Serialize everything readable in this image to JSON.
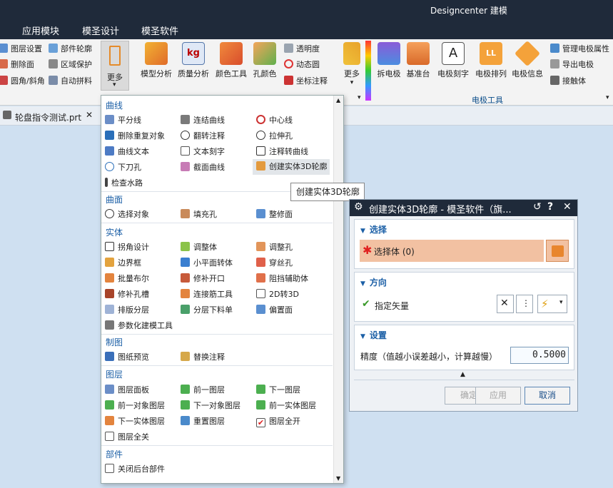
{
  "app": {
    "title": "Designcenter 建模"
  },
  "tabs": [
    "应用模块",
    "模圣设计",
    "模圣软件"
  ],
  "ribbon": {
    "small_col1": [
      "图层设置",
      "删除面",
      "圆角/斜角"
    ],
    "small_col2": [
      "部件轮廓",
      "区域保护",
      "自动拼料"
    ],
    "more1": "更多",
    "big1": [
      "模型分析",
      "质量分析",
      "颜色工具",
      "孔颜色"
    ],
    "small_col3": [
      "透明度",
      "动态圆",
      "坐标注释"
    ],
    "more2": "更多",
    "big2": [
      "拆电极",
      "基准台",
      "电极刻字",
      "电极排列",
      "电极信息"
    ],
    "small_col4": [
      "管理电极属性",
      "导出电极",
      "接触体"
    ],
    "group_label": "电极工具"
  },
  "document": {
    "tab": "轮盘指令测试.prt"
  },
  "menu": {
    "sections": [
      "曲线",
      "曲面",
      "实体",
      "制图",
      "图层",
      "部件"
    ],
    "curve": [
      "平分线",
      "连结曲线",
      "中心线",
      "删除重复对象",
      "翻转注释",
      "拉伸孔",
      "曲线文本",
      "文本刻字",
      "注释转曲线",
      "下刀孔",
      "截面曲线",
      "创建实体3D轮廓",
      "检查水路"
    ],
    "surface": [
      "选择对象",
      "填充孔",
      "整修面"
    ],
    "solid": [
      "拐角设计",
      "调整体",
      "调整孔",
      "边界框",
      "小平面转体",
      "穿丝孔",
      "批量布尔",
      "修补开口",
      "阻挡辅助体",
      "修补孔槽",
      "连接筋工具",
      "2D转3D",
      "排版分层",
      "分层下料单",
      "偏置面",
      "参数化建模工具"
    ],
    "drafting": [
      "图纸预览",
      "替换注释"
    ],
    "layer": [
      "图层面板",
      "前一图层",
      "下一图层",
      "前一对象图层",
      "下一对象图层",
      "前一实体图层",
      "下一实体图层",
      "重置图层",
      "图层全开",
      "图层全关"
    ],
    "part": [
      "关闭后台部件"
    ]
  },
  "tooltip": "创建实体3D轮廓",
  "dialog": {
    "title": "创建实体3D轮廓 - 模圣软件（旗...",
    "sec_select": "选择",
    "select_body": "选择体 (0)",
    "sec_direction": "方向",
    "specify_vector": "指定矢量",
    "sec_settings": "设置",
    "precision_label": "精度（值越小误差越小，计算越慢）",
    "precision_value": "0.5000",
    "ok": "确定",
    "apply": "应用",
    "cancel": "取消"
  },
  "colors": {
    "titlebar": "#1f2a3a",
    "accent": "#1ec8a4",
    "section": "#1b5fa6",
    "select_highlight": "#f2c1a2"
  }
}
